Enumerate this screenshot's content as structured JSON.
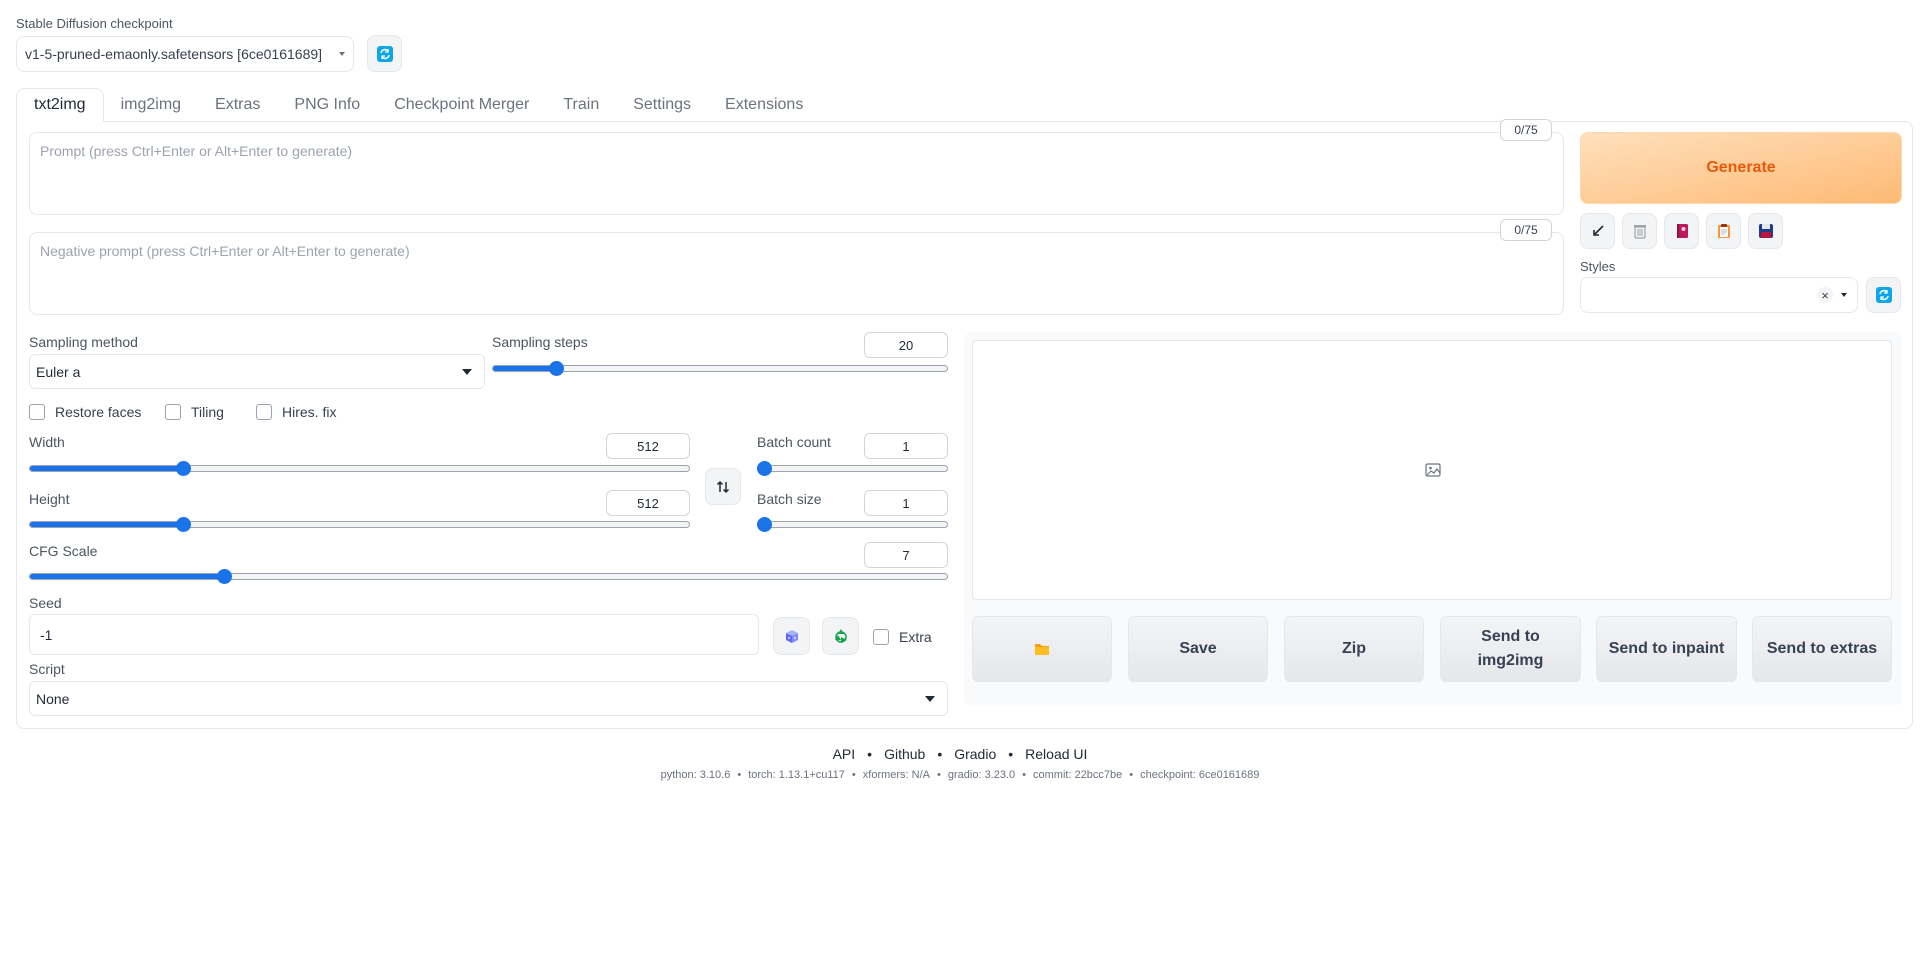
{
  "checkpoint": {
    "label": "Stable Diffusion checkpoint",
    "value": "v1-5-pruned-emaonly.safetensors [6ce0161689]"
  },
  "tabs": [
    {
      "label": "txt2img",
      "active": true
    },
    {
      "label": "img2img"
    },
    {
      "label": "Extras"
    },
    {
      "label": "PNG Info"
    },
    {
      "label": "Checkpoint Merger"
    },
    {
      "label": "Train"
    },
    {
      "label": "Settings"
    },
    {
      "label": "Extensions"
    }
  ],
  "prompt": {
    "placeholder": "Prompt (press Ctrl+Enter or Alt+Enter to generate)",
    "token_count": "0/75"
  },
  "negative_prompt": {
    "placeholder": "Negative prompt (press Ctrl+Enter or Alt+Enter to generate)",
    "token_count": "0/75"
  },
  "generate_label": "Generate",
  "tool_buttons": [
    "apply-arrow-icon",
    "trash-icon",
    "book-icon",
    "clipboard-icon",
    "save-disk-icon"
  ],
  "styles": {
    "label": "Styles",
    "value": ""
  },
  "sampling_method": {
    "label": "Sampling method",
    "value": "Euler a"
  },
  "sampling_steps": {
    "label": "Sampling steps",
    "value": "20",
    "min": 1,
    "max": 150
  },
  "checkboxes": {
    "restore_faces": "Restore faces",
    "tiling": "Tiling",
    "hires_fix": "Hires. fix"
  },
  "width": {
    "label": "Width",
    "value": "512",
    "fraction": 0.233
  },
  "height": {
    "label": "Height",
    "value": "512",
    "fraction": 0.233
  },
  "batch_count": {
    "label": "Batch count",
    "value": "1",
    "fraction": 0.0
  },
  "batch_size": {
    "label": "Batch size",
    "value": "1",
    "fraction": 0.0
  },
  "cfg_scale": {
    "label": "CFG Scale",
    "value": "7",
    "fraction": 0.212
  },
  "steps_fraction": 0.141,
  "seed": {
    "label": "Seed",
    "value": "-1",
    "extra_label": "Extra"
  },
  "script": {
    "label": "Script",
    "value": "None"
  },
  "output_buttons": {
    "folder": "folder-icon",
    "save": "Save",
    "zip": "Zip",
    "send_img2img": "Send to img2img",
    "send_inpaint": "Send to inpaint",
    "send_extras": "Send to extras"
  },
  "footer": {
    "links": [
      "API",
      "Github",
      "Gradio",
      "Reload UI"
    ],
    "versions": [
      "python: 3.10.6",
      "torch: 1.13.1+cu117",
      "xformers: N/A",
      "gradio: 3.23.0",
      "commit: 22bcc7be",
      "checkpoint: 6ce0161689"
    ]
  },
  "colors": {
    "accent": "#1a73e8",
    "generate_text": "#ea580c",
    "generate_bg": "#fdba74"
  }
}
